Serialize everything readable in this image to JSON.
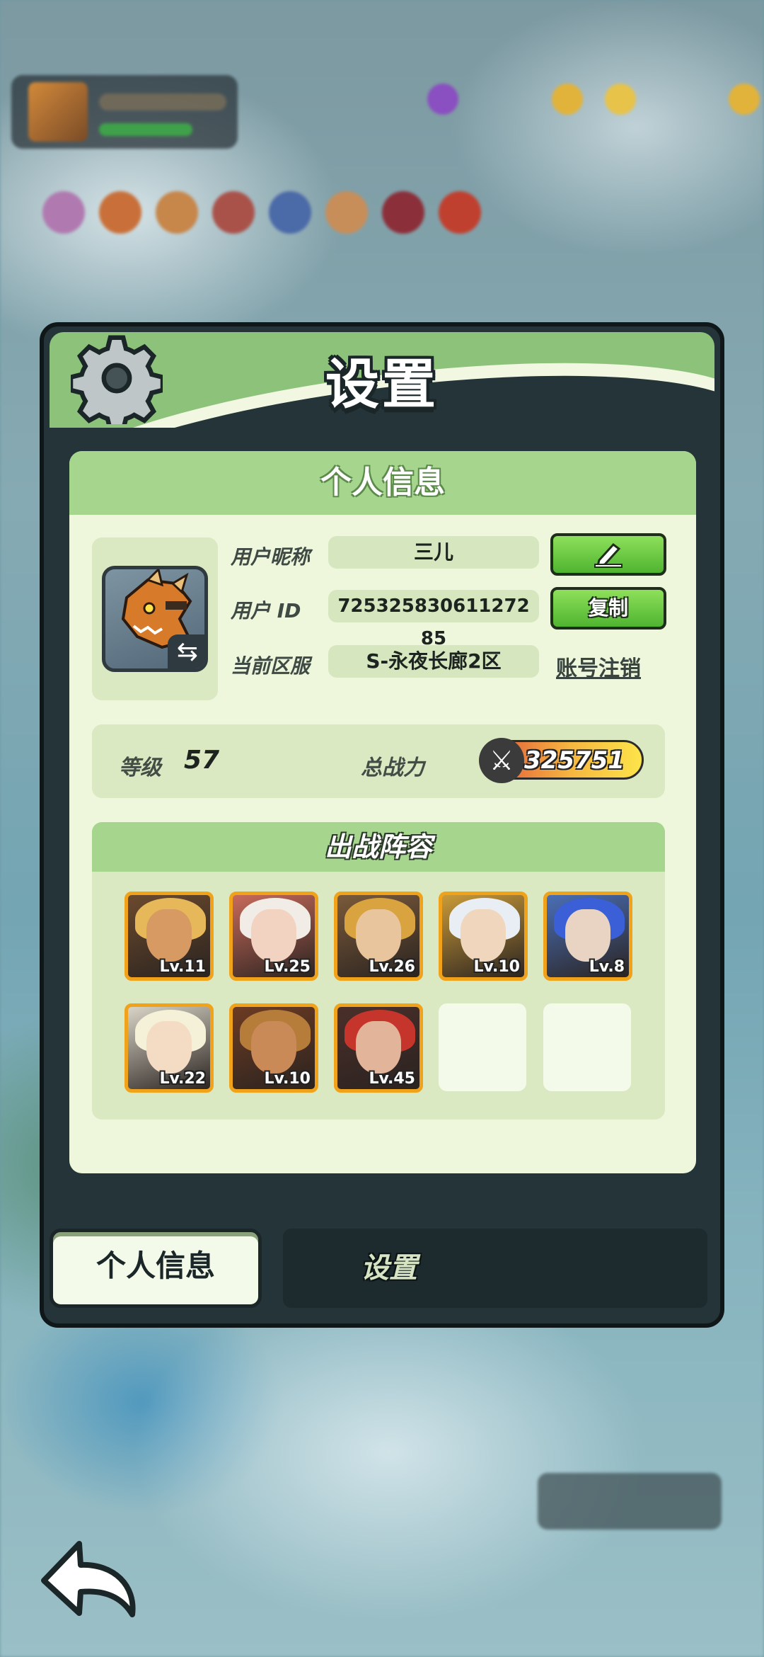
{
  "dialog": {
    "title": "设置",
    "section_title": "个人信息"
  },
  "profile": {
    "nickname_label": "用户昵称",
    "nickname_value": "三儿",
    "id_label": "用户  ID",
    "id_value": "725325830611272​85",
    "server_label": "当前区服",
    "server_value": "S-永夜长廊2区",
    "copy_button": "复制",
    "logout_link": "账号注销"
  },
  "stats": {
    "level_label": "等级",
    "level_value": "57",
    "power_label": "总战力",
    "power_value": "325751"
  },
  "lineup": {
    "title": "出战阵容",
    "heroes": [
      {
        "level": "Lv.11",
        "hair": "#e7b85a",
        "bg": "#6b4a2d",
        "skin": "#d79a62"
      },
      {
        "level": "Lv.25",
        "hair": "#f1ede6",
        "bg": "#c86a5a",
        "skin": "#f2d2c0"
      },
      {
        "level": "Lv.26",
        "hair": "#d9a440",
        "bg": "#7a5a3a",
        "skin": "#e9c59e"
      },
      {
        "level": "Lv.10",
        "hair": "#e8eef3",
        "bg": "#c99a38",
        "skin": "#f0d6bc"
      },
      {
        "level": "Lv.8",
        "hair": "#3b5fd6",
        "bg": "#4a6fb6",
        "skin": "#e9d4c4"
      },
      {
        "level": "Lv.22",
        "hair": "#f5f1d8",
        "bg": "#d8d4c6",
        "skin": "#f3dcc3"
      },
      {
        "level": "Lv.10",
        "hair": "#b57c3a",
        "bg": "#6d3b22",
        "skin": "#c98a58"
      },
      {
        "level": "Lv.45",
        "hair": "#c6352b",
        "bg": "#4a2f2a",
        "skin": "#e2b49a"
      }
    ]
  },
  "tabs": {
    "active": "个人信息",
    "inactive": "设置"
  }
}
